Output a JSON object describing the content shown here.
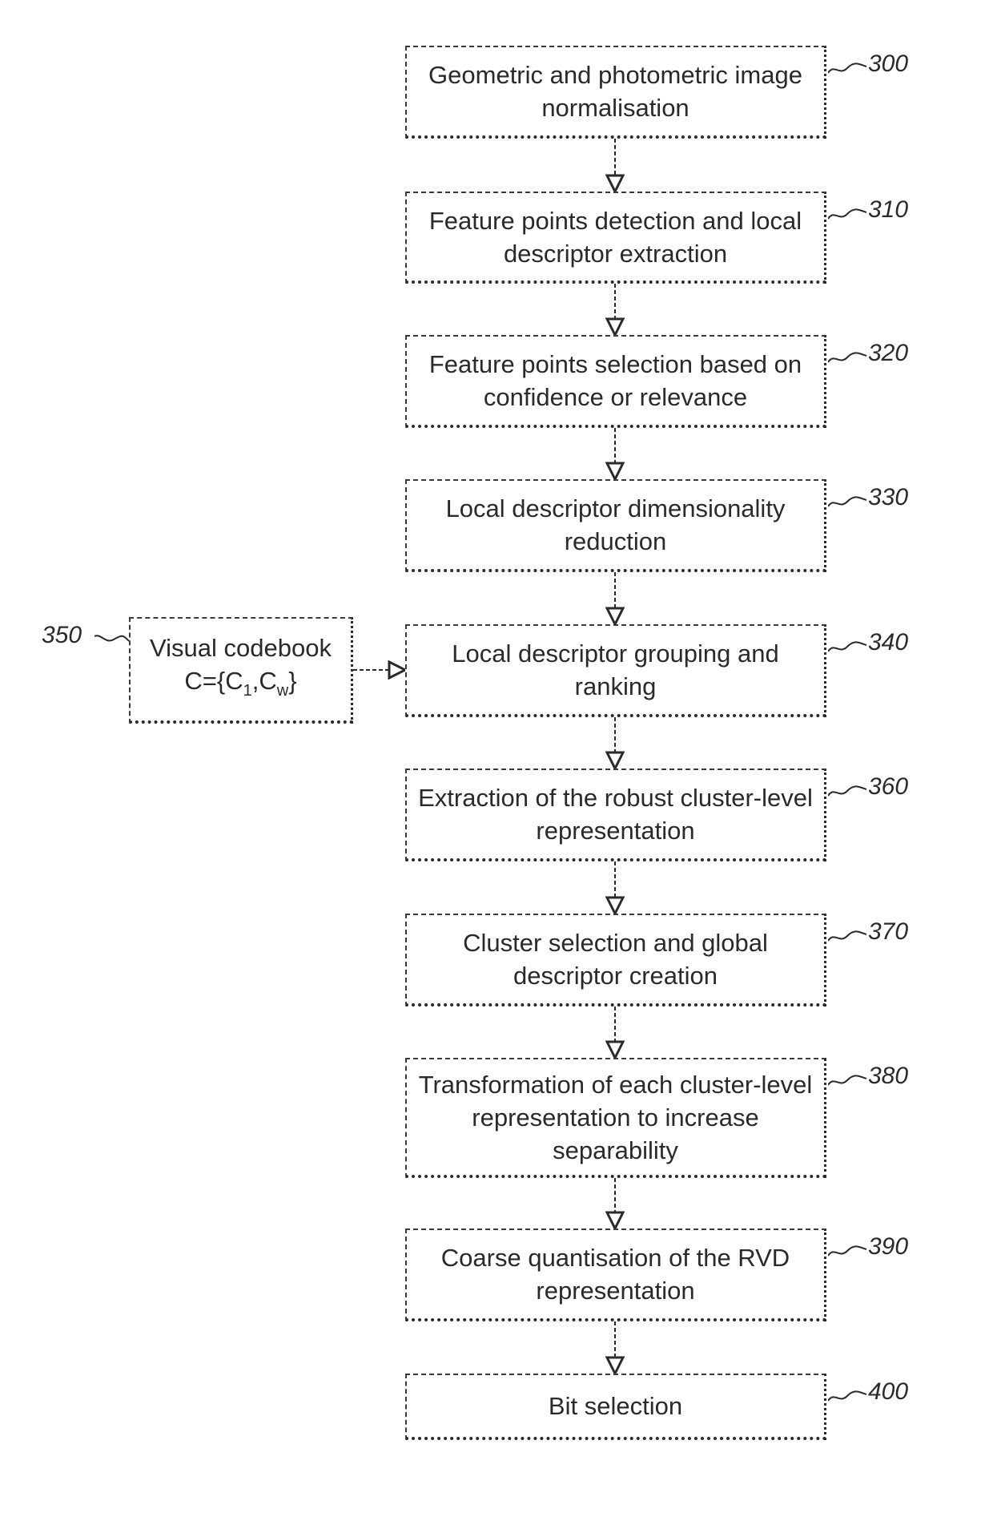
{
  "diagram": {
    "steps": [
      {
        "ref": "300",
        "text": "Geometric and photometric image normalisation"
      },
      {
        "ref": "310",
        "text": "Feature points detection and local descriptor extraction"
      },
      {
        "ref": "320",
        "text": "Feature points selection based on confidence or relevance"
      },
      {
        "ref": "330",
        "text": "Local descriptor dimensionality reduction"
      },
      {
        "ref": "340",
        "text": "Local descriptor grouping and ranking"
      },
      {
        "ref": "360",
        "text": "Extraction of the robust cluster-level representation"
      },
      {
        "ref": "370",
        "text": "Cluster selection and global descriptor creation"
      },
      {
        "ref": "380",
        "text": "Transformation of each cluster-level representation to increase separability"
      },
      {
        "ref": "390",
        "text": "Coarse quantisation of the RVD representation"
      },
      {
        "ref": "400",
        "text": "Bit selection"
      }
    ],
    "side_input": {
      "ref": "350",
      "line1": "Visual codebook",
      "formula_prefix": "C={C",
      "sub1": "1",
      "sep": ",C",
      "sub2": "w",
      "formula_suffix": "}",
      "target_ref": "340"
    }
  }
}
